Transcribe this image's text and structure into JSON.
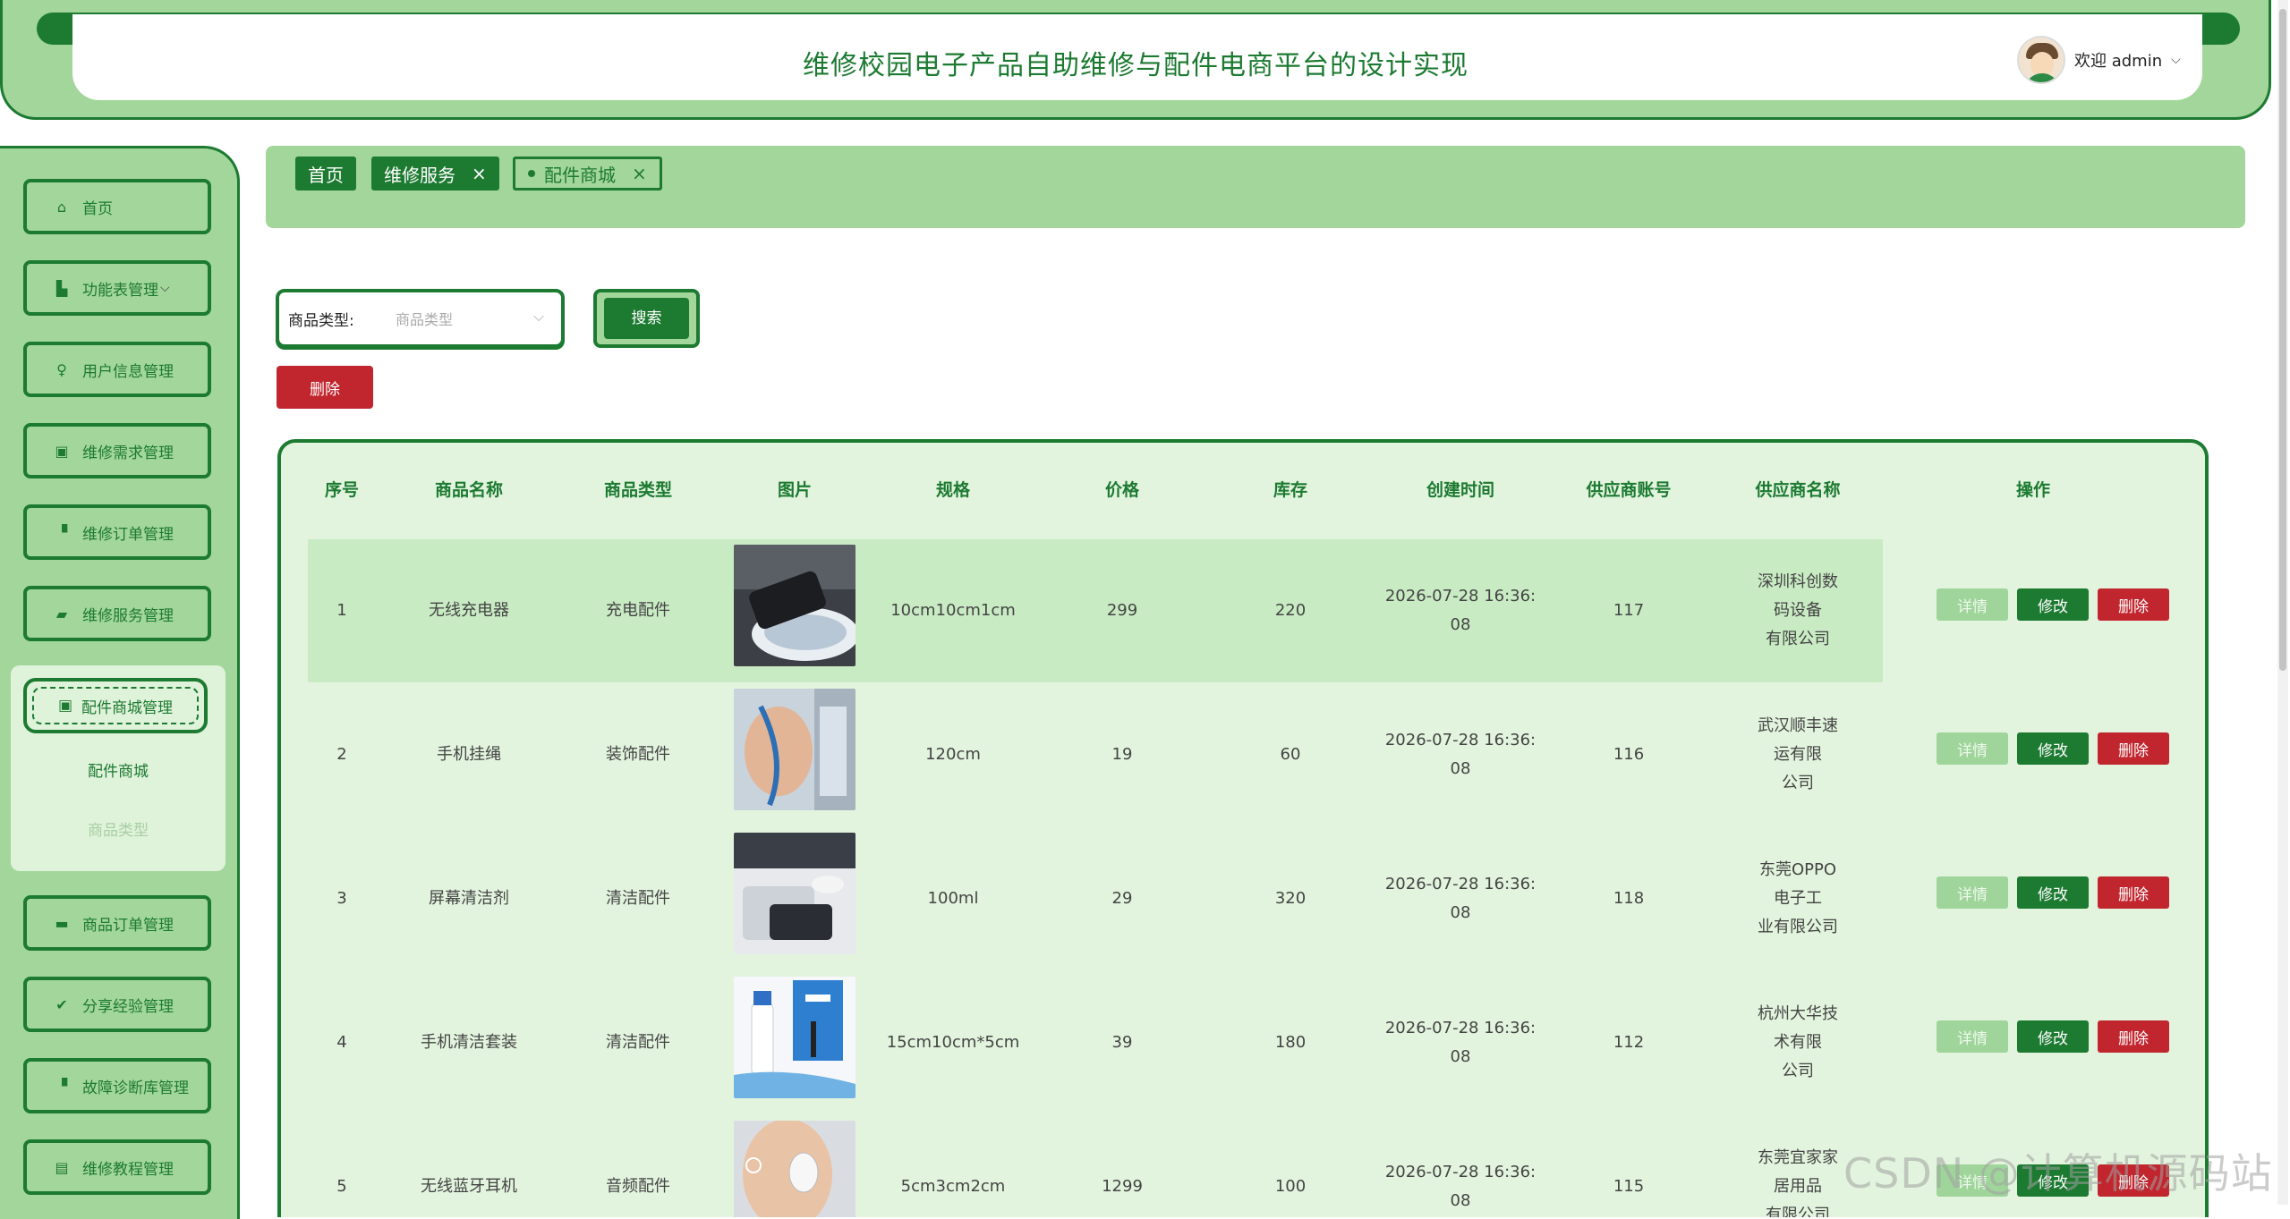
{
  "header": {
    "title": "维修校园电子产品自助维修与配件电商平台的设计实现",
    "welcome": "欢迎 admin"
  },
  "sidebar": {
    "items": [
      {
        "label": "首页",
        "icon": "home-icon"
      },
      {
        "label": "功能表管理",
        "icon": "building-icon"
      },
      {
        "label": "用户信息管理",
        "icon": "user-icon"
      },
      {
        "label": "维修需求管理",
        "icon": "chip-icon"
      },
      {
        "label": "维修订单管理",
        "icon": "order-icon"
      },
      {
        "label": "维修服务管理",
        "icon": "folder-icon"
      }
    ],
    "active": {
      "label": "配件商城管理",
      "icon": "chip-icon"
    },
    "sub_items": [
      "配件商城",
      "商品类型"
    ],
    "items_after": [
      {
        "label": "商品订单管理",
        "icon": "card-icon"
      },
      {
        "label": "分享经验管理",
        "icon": "check-circle-icon"
      },
      {
        "label": "故障诊断库管理",
        "icon": "order-icon"
      },
      {
        "label": "维修教程管理",
        "icon": "book-icon"
      }
    ]
  },
  "tabs": [
    {
      "label": "首页"
    },
    {
      "label": "维修服务"
    },
    {
      "label": "配件商城"
    }
  ],
  "search": {
    "label": "商品类型:",
    "placeholder": "商品类型",
    "button": "搜索",
    "delete_button": "删除"
  },
  "table": {
    "columns": [
      "序号",
      "商品名称",
      "商品类型",
      "图片",
      "规格",
      "价格",
      "库存",
      "创建时间",
      "供应商账号",
      "供应商名称",
      "操作"
    ],
    "rows": [
      {
        "no": "1",
        "name": "无线充电器",
        "type": "充电配件",
        "spec": "10cm10cm1cm",
        "price": "299",
        "stock": "220",
        "time1": "2026-07-28 16:36:",
        "time2": "08",
        "account": "117",
        "supplier1": "深圳科创数码设备",
        "supplier2": "有限公司"
      },
      {
        "no": "2",
        "name": "手机挂绳",
        "type": "装饰配件",
        "spec": "120cm",
        "price": "19",
        "stock": "60",
        "time1": "2026-07-28 16:36:",
        "time2": "08",
        "account": "116",
        "supplier1": "武汉顺丰速运有限",
        "supplier2": "公司"
      },
      {
        "no": "3",
        "name": "屏幕清洁剂",
        "type": "清洁配件",
        "spec": "100ml",
        "price": "29",
        "stock": "320",
        "time1": "2026-07-28 16:36:",
        "time2": "08",
        "account": "118",
        "supplier1": "东莞OPPO电子工",
        "supplier2": "业有限公司"
      },
      {
        "no": "4",
        "name": "手机清洁套装",
        "type": "清洁配件",
        "spec": "15cm10cm*5cm",
        "price": "39",
        "stock": "180",
        "time1": "2026-07-28 16:36:",
        "time2": "08",
        "account": "112",
        "supplier1": "杭州大华技术有限",
        "supplier2": "公司"
      },
      {
        "no": "5",
        "name": "无线蓝牙耳机",
        "type": "音频配件",
        "spec": "5cm3cm2cm",
        "price": "1299",
        "stock": "100",
        "time1": "2026-07-28 16:36:",
        "time2": "08",
        "account": "115",
        "supplier1": "东莞宜家家居用品",
        "supplier2": "有限公司"
      }
    ],
    "ops": {
      "detail": "详情",
      "edit": "修改",
      "delete": "删除"
    }
  },
  "watermark": "CSDN @计算机源码站",
  "colors": {
    "primary": "#1c7a31",
    "light": "#a3d69a",
    "danger": "#c1262e"
  }
}
